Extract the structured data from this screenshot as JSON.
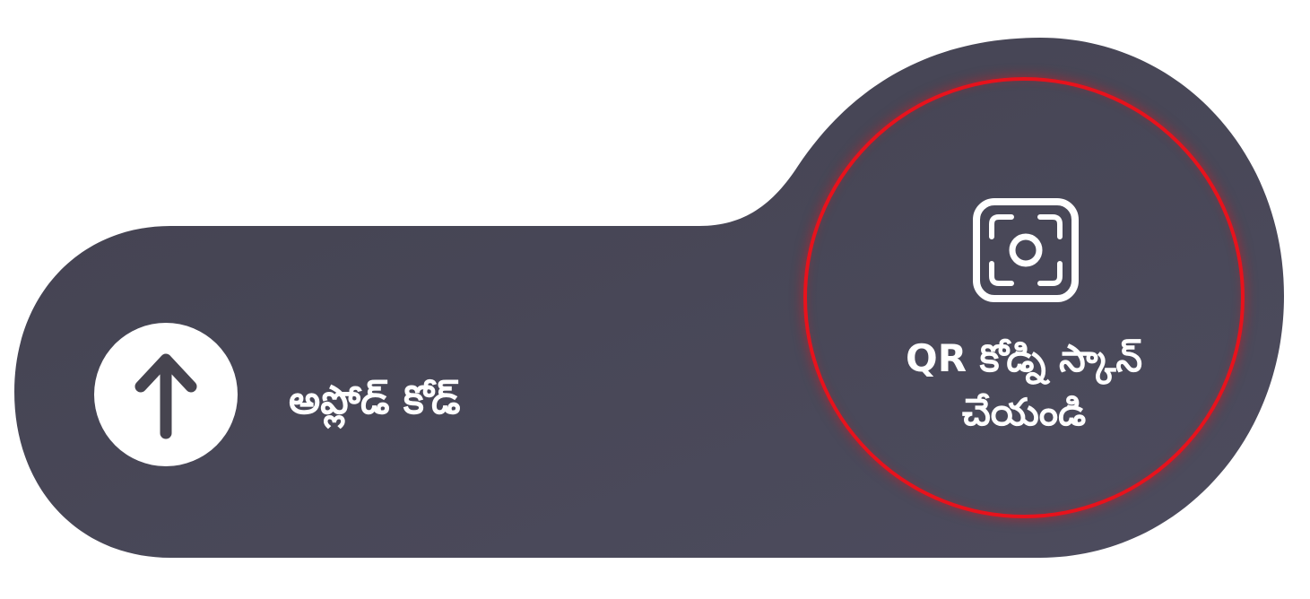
{
  "colors": {
    "panel_background": "#46444f",
    "panel_background_light": "#4d4c5e",
    "accent_ring": "#e8121c",
    "icon_and_text": "#ffffff"
  },
  "upload": {
    "icon": "arrow-up-icon",
    "label": "అప్లోడ్ కోడ్"
  },
  "scan": {
    "icon": "camera-scan-icon",
    "label_line1": "QR కోడ్ని స్కాన్",
    "label_line2": "చేయండి"
  }
}
